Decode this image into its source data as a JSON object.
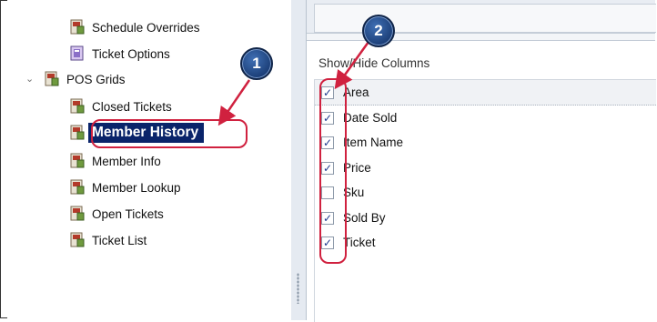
{
  "tree": {
    "items": [
      {
        "label": "Schedule Overrides",
        "icon": "report-icon",
        "selected": false
      },
      {
        "label": "Ticket Options",
        "icon": "options-icon",
        "selected": false
      },
      {
        "label": "POS Grids",
        "icon": "report-icon",
        "selected": false,
        "expanded": true
      },
      {
        "label": "Closed Tickets",
        "icon": "report-icon",
        "selected": false
      },
      {
        "label": "Member History",
        "icon": "report-icon",
        "selected": true
      },
      {
        "label": "Member Info",
        "icon": "report-icon",
        "selected": false
      },
      {
        "label": "Member Lookup",
        "icon": "report-icon",
        "selected": false
      },
      {
        "label": "Open Tickets",
        "icon": "report-icon",
        "selected": false
      },
      {
        "label": "Ticket List",
        "icon": "report-icon",
        "selected": false
      }
    ],
    "expander_icon": "chevron-down-icon"
  },
  "columns_panel": {
    "title": "Show/Hide Columns",
    "columns": [
      {
        "label": "Area",
        "checked": true
      },
      {
        "label": "Date Sold",
        "checked": true
      },
      {
        "label": "Item Name",
        "checked": true
      },
      {
        "label": "Price",
        "checked": true
      },
      {
        "label": "Sku",
        "checked": false
      },
      {
        "label": "Sold By",
        "checked": true
      },
      {
        "label": "Ticket",
        "checked": true
      }
    ]
  },
  "annotations": {
    "step1": "1",
    "step2": "2",
    "highlight_color": "#d0213f",
    "badge_color": "#2a5298"
  },
  "colors": {
    "selection_bg": "#0a246a",
    "selection_text": "#ffffff",
    "check_color": "#1d3b8f"
  }
}
